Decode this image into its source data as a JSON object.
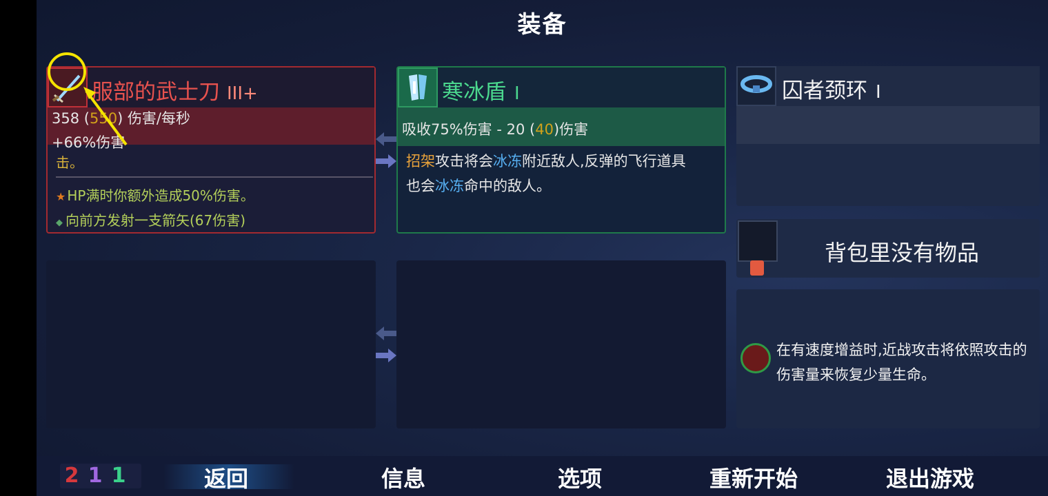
{
  "title": "装备",
  "weapon": {
    "name": "服部的武士刀",
    "tier": "III+",
    "dps_main": "358",
    "dps_open": " (",
    "dps_boost": "550",
    "dps_close": ") 伤害/每秒",
    "bonus": "+66%伤害",
    "fragment": "击。",
    "affix1": "HP满时你额外造成50%伤害。",
    "affix2": "向前方发射一支箭矢(67伤害)"
  },
  "shield": {
    "name": "寒冰盾",
    "tier": "I",
    "stat_a": "吸收75%伤害 - 20 (",
    "stat_b": "40",
    "stat_c": ")伤害",
    "desc_1": "招架",
    "desc_2": "攻击将会",
    "desc_3": "冰冻",
    "desc_4": "附近敌人,反弹的飞行道具",
    "desc_5": "也会",
    "desc_6": "冰冻",
    "desc_7": "命中的敌人。"
  },
  "amulet": {
    "name": "囚者颈环",
    "tier": "I"
  },
  "backpack": {
    "empty_text": "背包里没有物品"
  },
  "mutation": {
    "text": "在有速度增益时,近战攻击将依照攻击的伤害量来恢复少量生命。"
  },
  "counters": {
    "red": "2",
    "purple": "1",
    "green": "1"
  },
  "menu": {
    "back": "返回",
    "info": "信息",
    "options": "选项",
    "restart": "重新开始",
    "quit": "退出游戏"
  },
  "colors": {
    "weapon_border": "#a32a30",
    "shield_border": "#1f7a4a",
    "gold": "#d2a21a",
    "freeze": "#56aef0",
    "annotation": "#f5e400"
  }
}
